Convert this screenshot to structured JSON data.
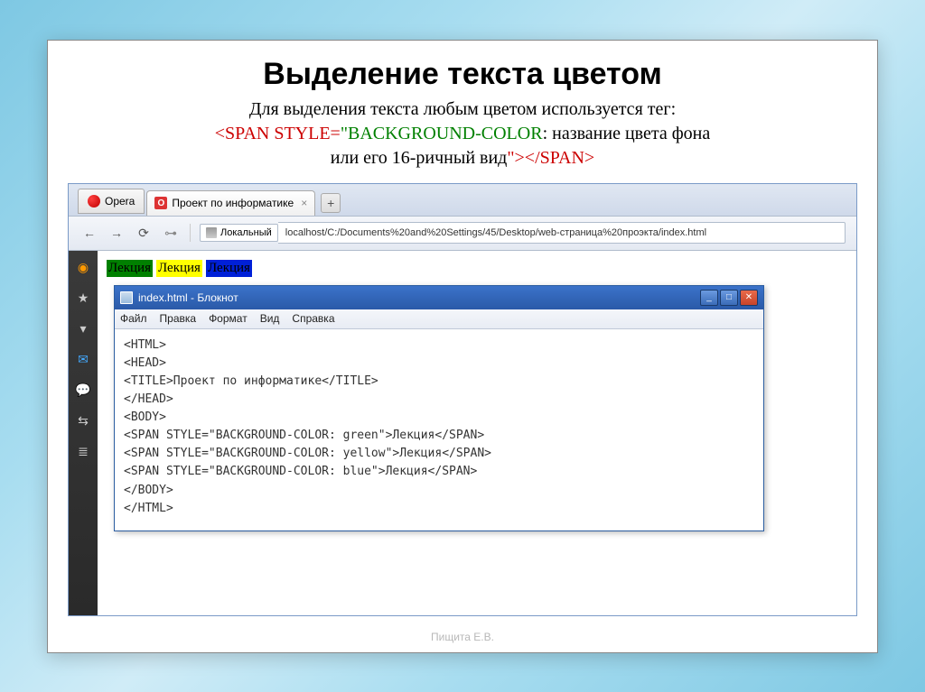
{
  "slide": {
    "title": "Выделение текста цветом",
    "desc1": "Для выделения текста любым цветом используется тег:",
    "desc2a": "<SPAN STYLE=",
    "desc2b": "\"BACKGROUND-COLOR",
    "desc2c": ": название цвета фона",
    "desc3": "или его 16-ричный вид",
    "desc3b": "\">",
    "desc3c": "</SPAN>",
    "footer": "Пищита Е.В."
  },
  "browser": {
    "opera_label": "Opera",
    "tab_label": "Проект по информатике",
    "addr_label": "Локальный",
    "url": "localhost/C:/Documents%20and%20Settings/45/Desktop/web-страница%20проэкта/index.html",
    "highlights": [
      "Лекция",
      "Лекция",
      "Лекция"
    ]
  },
  "notepad": {
    "title": "index.html - Блокнот",
    "menu": [
      "Файл",
      "Правка",
      "Формат",
      "Вид",
      "Справка"
    ],
    "code": "<HTML>\n<HEAD>\n<TITLE>Проект по информатике</TITLE>\n</HEAD>\n<BODY>\n<SPAN STYLE=\"BACKGROUND-COLOR: green\">Лекция</SPAN>\n<SPAN STYLE=\"BACKGROUND-COLOR: yellow\">Лекция</SPAN>\n<SPAN STYLE=\"BACKGROUND-COLOR: blue\">Лекция</SPAN>\n</BODY>\n</HTML>"
  }
}
